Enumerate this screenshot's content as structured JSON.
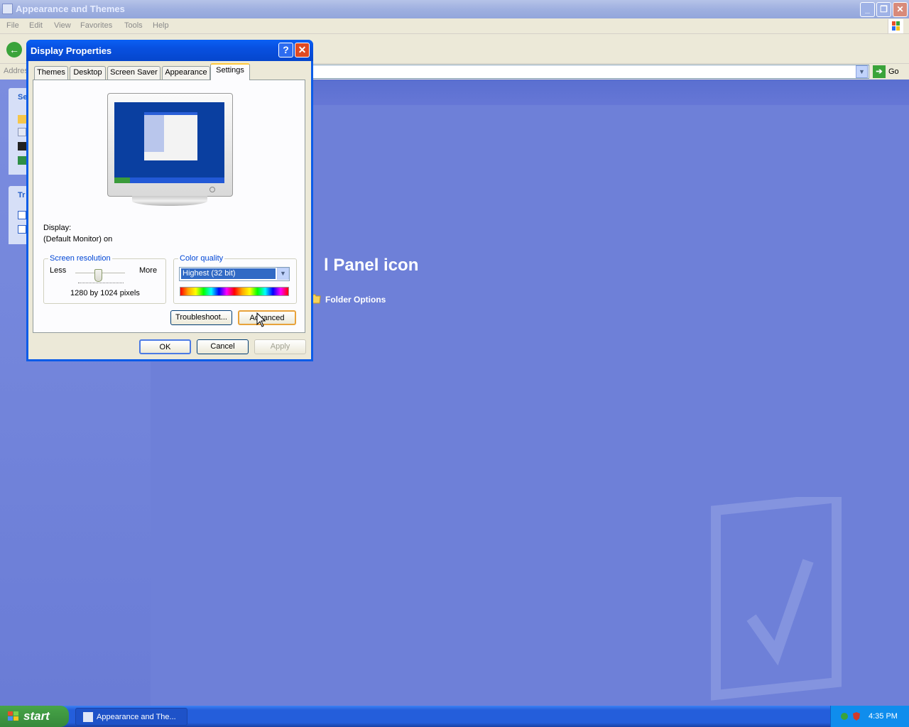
{
  "window": {
    "title": "Appearance and Themes",
    "minimize_icon": "minimize-icon",
    "restore_icon": "restore-icon",
    "close_icon": "close-icon"
  },
  "menu": [
    "File",
    "Edit",
    "View",
    "Favorites",
    "Tools",
    "Help"
  ],
  "address": {
    "label": "Addres",
    "go": "Go"
  },
  "left_panel": {
    "box1_head": "Se",
    "box2_head": "Tr"
  },
  "main": {
    "heading": "l Panel icon",
    "folder_options": "Folder Options"
  },
  "dialog": {
    "title": "Display Properties",
    "help": "?",
    "close": "✕",
    "tabs": [
      "Themes",
      "Desktop",
      "Screen Saver",
      "Appearance",
      "Settings"
    ],
    "active_tab": "Settings",
    "display_label": "Display:",
    "display_value": "(Default Monitor) on",
    "resolution": {
      "label": "Screen resolution",
      "less": "Less",
      "more": "More",
      "value": "1280 by 1024 pixels",
      "slider_position": 0.45
    },
    "color": {
      "label": "Color quality",
      "selected": "Highest (32 bit)"
    },
    "buttons": {
      "troubleshoot": "Troubleshoot...",
      "advanced": "Advanced",
      "ok": "OK",
      "cancel": "Cancel",
      "apply": "Apply"
    }
  },
  "taskbar": {
    "start": "start",
    "task": "Appearance and The...",
    "clock": "4:35 PM"
  },
  "colors": {
    "desktop": "#6375d6",
    "title_active": "#0a5cf0",
    "taskbar": "#245edb",
    "start_green": "#3a9b3a"
  }
}
